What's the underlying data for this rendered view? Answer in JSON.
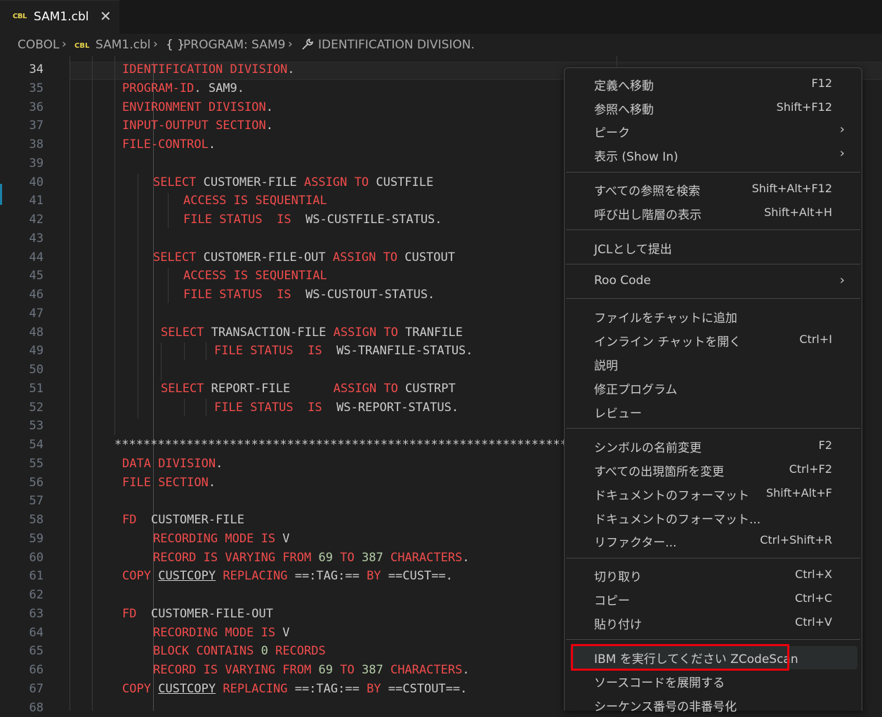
{
  "tab": {
    "badge": "CBL",
    "filename": "SAM1.cbl",
    "close_glyph": "✕"
  },
  "breadcrumb": {
    "root": "COBOL",
    "sep": "›",
    "badge": "CBL",
    "file": "SAM1.cbl",
    "program_icon": "{ }",
    "program": "PROGRAM: SAM9",
    "division": "IDENTIFICATION DIVISION."
  },
  "line_numbers": [
    "34",
    "35",
    "36",
    "37",
    "38",
    "39",
    "40",
    "41",
    "42",
    "43",
    "44",
    "45",
    "46",
    "47",
    "48",
    "49",
    "50",
    "51",
    "52",
    "53",
    "54",
    "55",
    "56",
    "57",
    "58",
    "59",
    "60",
    "61",
    "62",
    "63",
    "64",
    "65",
    "66",
    "67",
    "68"
  ],
  "code": {
    "l34": {
      "a": "IDENTIFICATION",
      "b": " DIVISION",
      "c": "."
    },
    "l35": {
      "a": "PROGRAM-ID",
      "b": ". SAM9."
    },
    "l36": {
      "a": "ENVIRONMENT",
      "b": " DIVISION",
      "c": "."
    },
    "l37": {
      "a": "INPUT-OUTPUT",
      "b": " SECTION",
      "c": "."
    },
    "l38": {
      "a": "FILE-CONTROL",
      "b": "."
    },
    "l40": {
      "a": "SELECT",
      "b": " CUSTOMER-FILE ",
      "c": "ASSIGN",
      "d": " ",
      "e": "TO",
      "f": " CUSTFILE"
    },
    "l41": {
      "a": "ACCESS",
      "b": " ",
      "c": "IS",
      "d": " ",
      "e": "SEQUENTIAL"
    },
    "l42": {
      "a": "FILE",
      "b": " ",
      "c": "STATUS",
      "d": "  ",
      "e": "IS",
      "f": "  WS-CUSTFILE-STATUS."
    },
    "l44": {
      "a": "SELECT",
      "b": " CUSTOMER-FILE-OUT ",
      "c": "ASSIGN",
      "d": " ",
      "e": "TO",
      "f": " CUSTOUT"
    },
    "l45": {
      "a": "ACCESS",
      "b": " ",
      "c": "IS",
      "d": " ",
      "e": "SEQUENTIAL"
    },
    "l46": {
      "a": "FILE",
      "b": " ",
      "c": "STATUS",
      "d": "  ",
      "e": "IS",
      "f": "  WS-CUSTOUT-STATUS."
    },
    "l48": {
      "a": "SELECT",
      "b": " TRANSACTION-FILE ",
      "c": "ASSIGN",
      "d": " ",
      "e": "TO",
      "f": " TRANFILE"
    },
    "l49": {
      "a": "FILE",
      "b": " ",
      "c": "STATUS",
      "d": "  ",
      "e": "IS",
      "f": "  WS-TRANFILE-STATUS."
    },
    "l51": {
      "a": "SELECT",
      "b": " REPORT-FILE      ",
      "c": "ASSIGN",
      "d": " ",
      "e": "TO",
      "f": " CUSTRPT"
    },
    "l52": {
      "a": "FILE",
      "b": " ",
      "c": "STATUS",
      "d": "  ",
      "e": "IS",
      "f": "  WS-REPORT-STATUS."
    },
    "l54": {
      "a": "*****************************************************************"
    },
    "l55": {
      "a": "DATA",
      "b": " DIVISION",
      "c": "."
    },
    "l56": {
      "a": "FILE",
      "b": " SECTION",
      "c": "."
    },
    "l58": {
      "a": "FD",
      "b": "  CUSTOMER-FILE"
    },
    "l59": {
      "a": "RECORDING",
      "b": " ",
      "c": "MODE",
      "d": " ",
      "e": "IS",
      "f": " V"
    },
    "l60": {
      "a": "RECORD",
      "b": " ",
      "c": "IS",
      "d": " ",
      "e": "VARYING",
      "f": " ",
      "g": "FROM",
      "h": " ",
      "i": "69",
      "j": " ",
      "k": "TO",
      "l": " ",
      "m": "387",
      "n": " ",
      "o": "CHARACTERS",
      "p": "."
    },
    "l61": {
      "a": "COPY",
      "b": " ",
      "c": "CUSTCOPY",
      "d": " ",
      "e": "REPLACING",
      "f": " ==:TAG:== ",
      "g": "BY",
      "h": " ==CUST==."
    },
    "l63": {
      "a": "FD",
      "b": "  CUSTOMER-FILE-OUT"
    },
    "l64": {
      "a": "RECORDING",
      "b": " ",
      "c": "MODE",
      "d": " ",
      "e": "IS",
      "f": " V"
    },
    "l65": {
      "a": "BLOCK",
      "b": " ",
      "c": "CONTAINS",
      "d": " ",
      "e": "0",
      "f": " ",
      "g": "RECORDS"
    },
    "l66": {
      "a": "RECORD",
      "b": " ",
      "c": "IS",
      "d": " ",
      "e": "VARYING",
      "f": " ",
      "g": "FROM",
      "h": " ",
      "i": "69",
      "j": " ",
      "k": "TO",
      "l": " ",
      "m": "387",
      "n": " ",
      "o": "CHARACTERS",
      "p": "."
    },
    "l67": {
      "a": "COPY",
      "b": " ",
      "c": "CUSTCOPY",
      "d": " ",
      "e": "REPLACING",
      "f": " ==:TAG:== ",
      "g": "BY",
      "h": " ==CSTOUT==."
    }
  },
  "menu": {
    "goto_def": {
      "label": "定義へ移動",
      "key": "F12"
    },
    "goto_ref": {
      "label": "参照へ移動",
      "key": "Shift+F12"
    },
    "peek": {
      "label": "ピーク",
      "chev": "›"
    },
    "show_in": {
      "label": "表示 (Show In)",
      "chev": "›"
    },
    "find_all_refs": {
      "label": "すべての参照を検索",
      "key": "Shift+Alt+F12"
    },
    "call_hierarchy": {
      "label": "呼び出し階層の表示",
      "key": "Shift+Alt+H"
    },
    "submit_jcl": {
      "label": "JCLとして提出"
    },
    "roo_code": {
      "label": "Roo Code",
      "chev": "›"
    },
    "add_to_chat": {
      "label": "ファイルをチャットに追加"
    },
    "inline_chat": {
      "label": "インライン チャットを開く",
      "key": "Ctrl+I"
    },
    "explain": {
      "label": "説明"
    },
    "fix": {
      "label": "修正プログラム"
    },
    "review": {
      "label": "レビュー"
    },
    "rename": {
      "label": "シンボルの名前変更",
      "key": "F2"
    },
    "change_all": {
      "label": "すべての出現箇所を変更",
      "key": "Ctrl+F2"
    },
    "format_doc": {
      "label": "ドキュメントのフォーマット",
      "key": "Shift+Alt+F"
    },
    "format_doc_with": {
      "label": "ドキュメントのフォーマット..."
    },
    "refactor": {
      "label": "リファクター...",
      "key": "Ctrl+Shift+R"
    },
    "cut": {
      "label": "切り取り",
      "key": "Ctrl+X"
    },
    "copy": {
      "label": "コピー",
      "key": "Ctrl+C"
    },
    "paste": {
      "label": "貼り付け",
      "key": "Ctrl+V"
    },
    "zcodescan": {
      "label": "IBM を実行してください ZCodeScan"
    },
    "expand_source": {
      "label": "ソースコードを展開する"
    },
    "unnumber": {
      "label": "シーケンス番号の非番号化"
    }
  },
  "colors": {
    "keyword": "#f14c4c",
    "identifier": "#cccccc",
    "number": "#b5cea8",
    "highlight_box": "#e8000d",
    "badge": "#e8d44d"
  }
}
